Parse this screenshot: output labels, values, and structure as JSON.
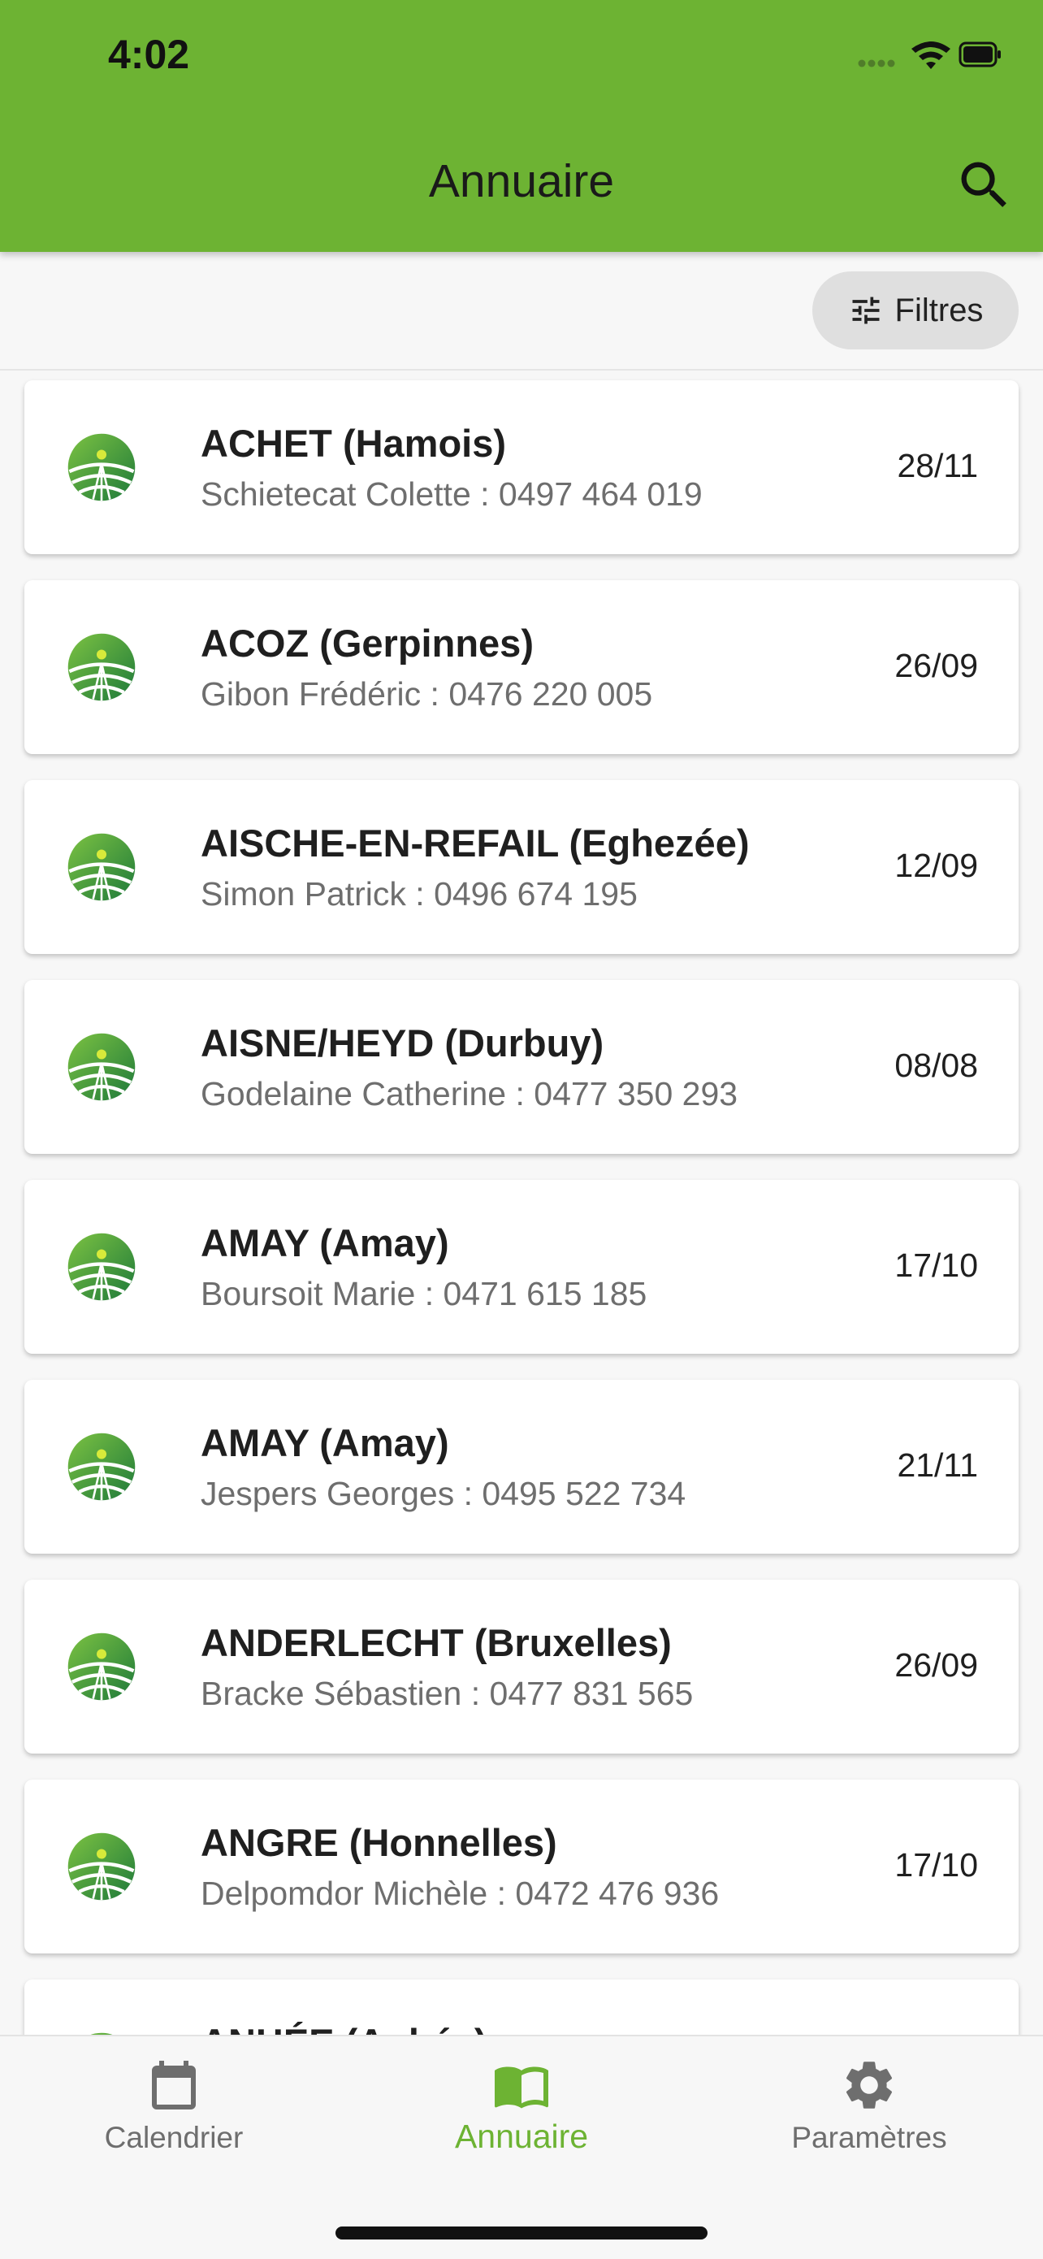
{
  "status_bar": {
    "time": "4:02"
  },
  "header": {
    "title": "Annuaire",
    "search_icon": "search-icon"
  },
  "filters": {
    "label": "Filtres",
    "icon": "tune-icon"
  },
  "theme": {
    "accent": "#6db333",
    "logo_dark": "#1e7a3a",
    "logo_light": "#7cc242"
  },
  "entries": [
    {
      "name": "ACHET (Hamois)",
      "contact": "Schietecat Colette : 0497 464 019",
      "date": "28/11"
    },
    {
      "name": "ACOZ (Gerpinnes)",
      "contact": "Gibon Frédéric : 0476 220 005",
      "date": "26/09"
    },
    {
      "name": "AISCHE-EN-REFAIL (Eghezée)",
      "contact": "Simon Patrick : 0496 674 195",
      "date": "12/09"
    },
    {
      "name": "AISNE/HEYD (Durbuy)",
      "contact": "Godelaine Catherine : 0477 350 293",
      "date": "08/08"
    },
    {
      "name": "AMAY (Amay)",
      "contact": "Boursoit Marie : 0471 615 185",
      "date": "17/10"
    },
    {
      "name": "AMAY (Amay)",
      "contact": "Jespers Georges : 0495 522 734",
      "date": "21/11"
    },
    {
      "name": "ANDERLECHT (Bruxelles)",
      "contact": "Bracke Sébastien : 0477 831 565",
      "date": "26/09"
    },
    {
      "name": "ANGRE (Honnelles)",
      "contact": "Delpomdor Michèle : 0472 476 936",
      "date": "17/10"
    },
    {
      "name": "ANHÉE (Anhée)",
      "contact": "",
      "date": ""
    }
  ],
  "bottom_nav": {
    "items": [
      {
        "label": "Calendrier",
        "icon": "calendar-icon",
        "active": false
      },
      {
        "label": "Annuaire",
        "icon": "book-icon",
        "active": true
      },
      {
        "label": "Paramètres",
        "icon": "gear-icon",
        "active": false
      }
    ]
  }
}
